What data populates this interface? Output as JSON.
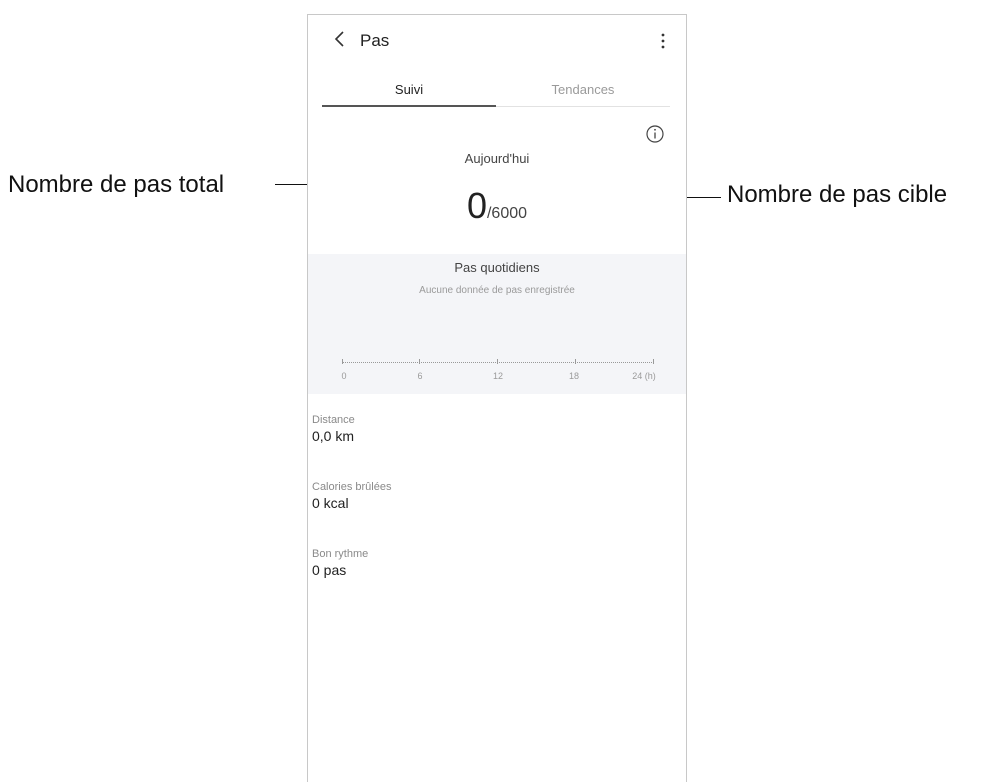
{
  "callouts": {
    "total_steps": "Nombre de pas total",
    "target_steps": "Nombre de pas cible"
  },
  "header": {
    "title": "Pas",
    "back_icon": "chevron-left-icon",
    "more_icon": "more-vertical-icon"
  },
  "tabs": [
    {
      "label": "Suivi",
      "active": true
    },
    {
      "label": "Tendances",
      "active": false
    }
  ],
  "summary": {
    "info_icon": "info-icon",
    "today_label": "Aujourd'hui",
    "steps_count": "0",
    "steps_target": "/6000",
    "steps_caption": "Pas quotidiens"
  },
  "chart": {
    "empty_message": "Aucune donnée de pas enregistrée",
    "x_ticks": [
      "0",
      "6",
      "12",
      "18",
      "24 (h)"
    ]
  },
  "stats": [
    {
      "label": "Distance",
      "value": "0,0 km"
    },
    {
      "label": "Calories brûlées",
      "value": "0 kcal"
    },
    {
      "label": "Bon rythme",
      "value": "0 pas"
    }
  ],
  "colors": {
    "chart_background": "#f4f5f8",
    "tab_active_underline": "#555555",
    "text_primary": "#222222",
    "text_secondary": "#9a9a9a"
  }
}
